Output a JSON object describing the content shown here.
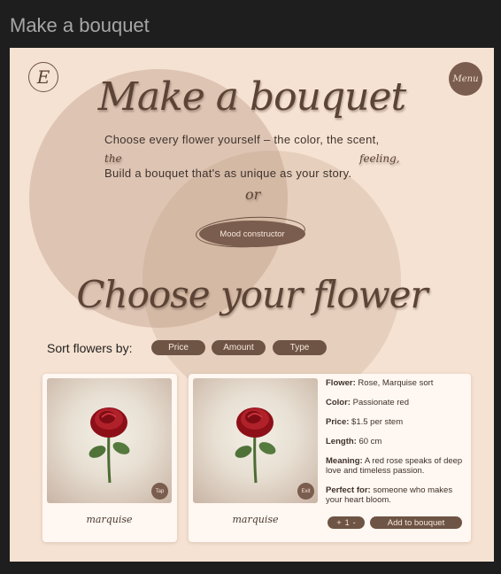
{
  "frame": {
    "title": "Make a bouquet"
  },
  "header": {
    "logo_letter": "E",
    "menu_label": "Menu"
  },
  "hero": {
    "title": "Make a bouquet",
    "line1": "Choose every flower yourself – the color, the scent,",
    "word_the": "the",
    "word_feeling": "feeling,",
    "line2": "Build a bouquet that's as unique as your story.",
    "or": "or",
    "mood_button": "Mood constructor"
  },
  "section": {
    "title": "Choose your flower"
  },
  "sort": {
    "label": "Sort flowers by:",
    "options": [
      "Price",
      "Amount",
      "Type"
    ]
  },
  "cards": [
    {
      "name": "marquise",
      "badge": "Tap"
    },
    {
      "name": "marquise",
      "badge": "Exit",
      "details": {
        "flower_label": "Flower:",
        "flower_value": "Rose, Marquise sort",
        "color_label": "Color:",
        "color_value": "Passionate red",
        "price_label": "Price:",
        "price_value": "$1.5 per stem",
        "length_label": "Length:",
        "length_value": "60 cm",
        "meaning_label": "Meaning:",
        "meaning_value": "A red rose speaks of deep love and timeless passion.",
        "perfect_label": "Perfect for:",
        "perfect_value": "someone who makes your heart bloom."
      },
      "quantity": {
        "plus": "+",
        "value": "1",
        "minus": "-"
      },
      "add_button": "Add to bouquet"
    }
  ],
  "colors": {
    "background": "#f6e2d2",
    "accent": "#6e5445",
    "text": "#3e322b"
  },
  "icons": [
    "logo-monogram-icon",
    "rose-image"
  ]
}
